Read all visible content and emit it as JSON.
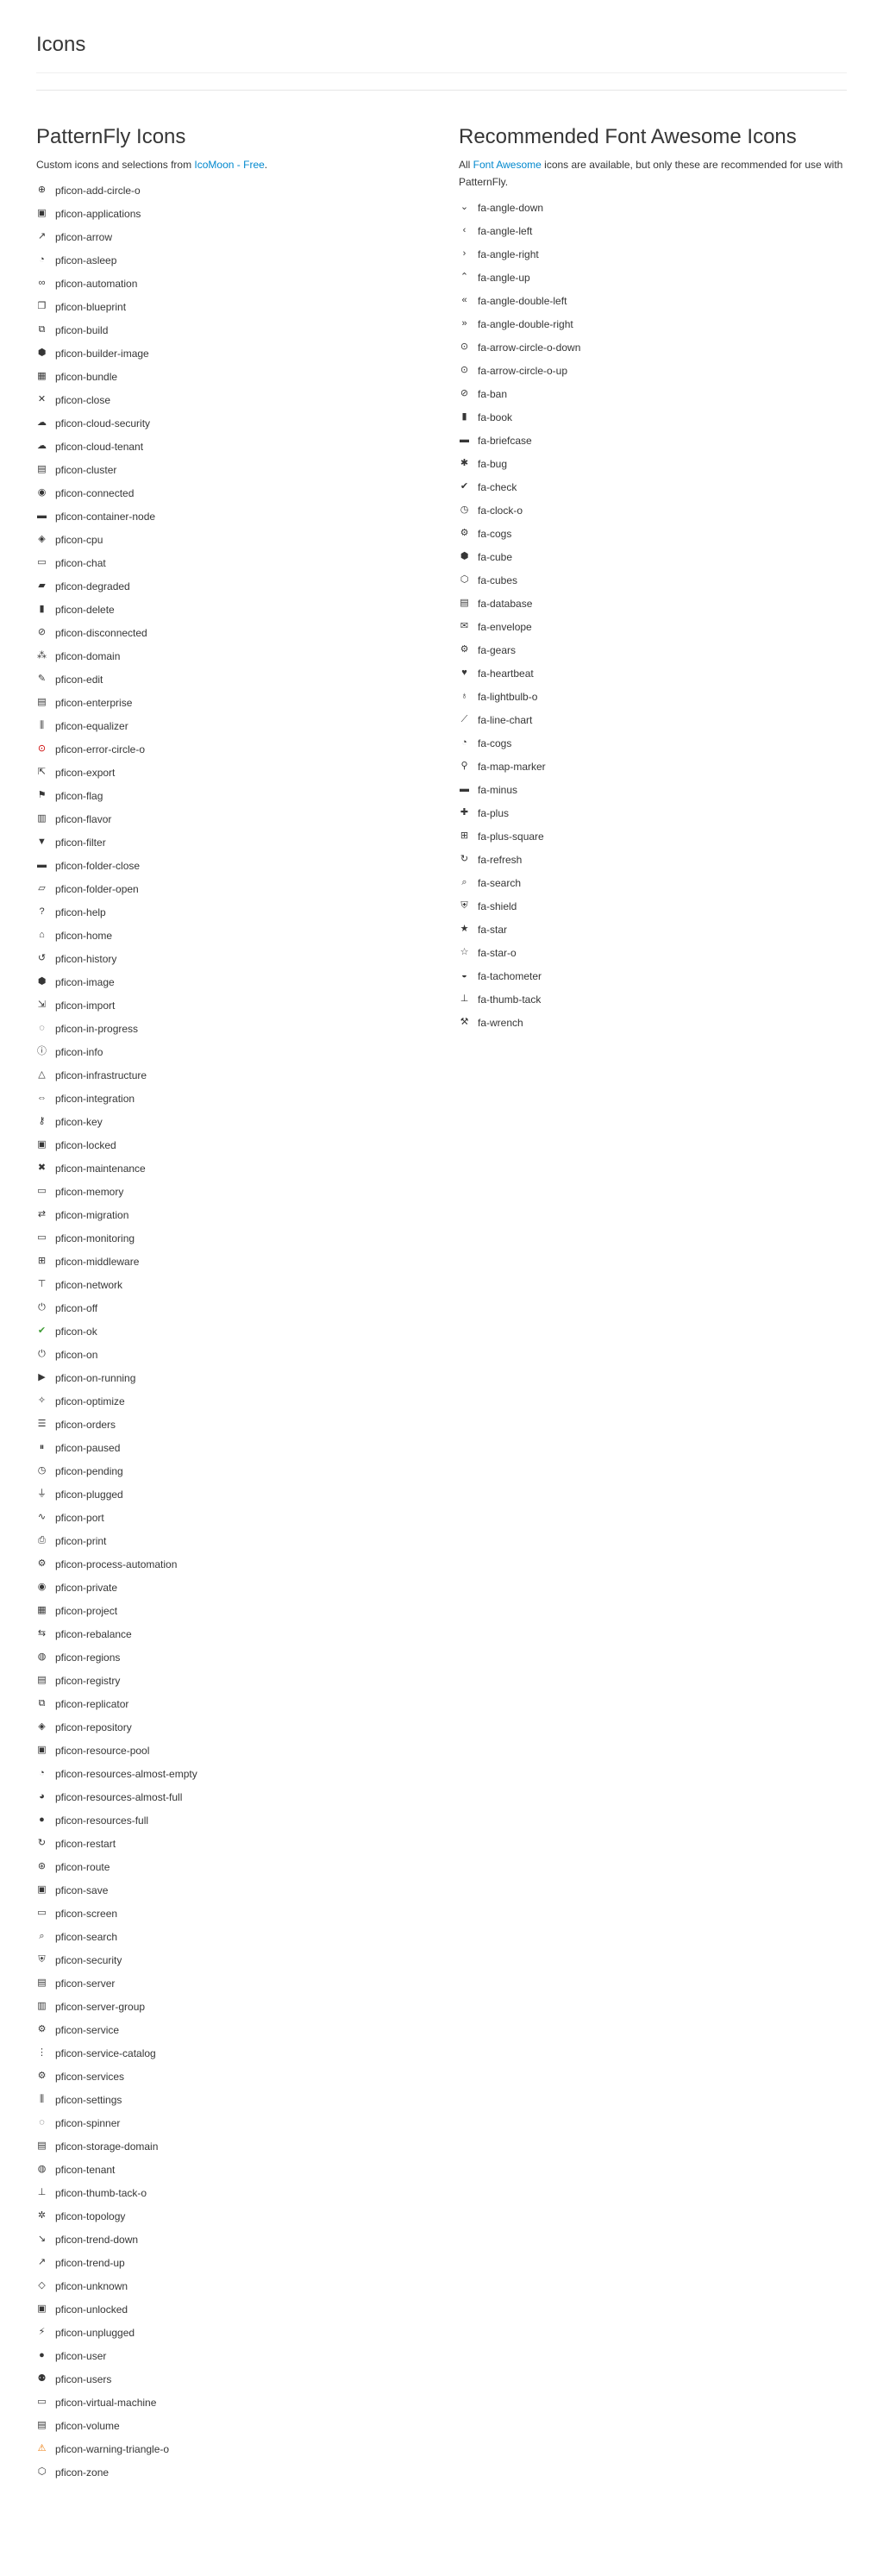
{
  "page": {
    "title": "Icons"
  },
  "left": {
    "title": "PatternFly Icons",
    "description_prefix": "Custom icons and selections from ",
    "description_link": "IcoMoon - Free",
    "description_suffix": ".",
    "icons": [
      {
        "name": "pficon-add-circle-o",
        "glyph": "⊕",
        "cls": ""
      },
      {
        "name": "pficon-applications",
        "glyph": "▣",
        "cls": ""
      },
      {
        "name": "pficon-arrow",
        "glyph": "↗",
        "cls": ""
      },
      {
        "name": "pficon-asleep",
        "glyph": "◔",
        "cls": ""
      },
      {
        "name": "pficon-automation",
        "glyph": "∞",
        "cls": ""
      },
      {
        "name": "pficon-blueprint",
        "glyph": "❐",
        "cls": ""
      },
      {
        "name": "pficon-build",
        "glyph": "⧉",
        "cls": ""
      },
      {
        "name": "pficon-builder-image",
        "glyph": "⬢",
        "cls": ""
      },
      {
        "name": "pficon-bundle",
        "glyph": "▦",
        "cls": ""
      },
      {
        "name": "pficon-close",
        "glyph": "✕",
        "cls": ""
      },
      {
        "name": "pficon-cloud-security",
        "glyph": "☁",
        "cls": ""
      },
      {
        "name": "pficon-cloud-tenant",
        "glyph": "☁",
        "cls": ""
      },
      {
        "name": "pficon-cluster",
        "glyph": "▤",
        "cls": ""
      },
      {
        "name": "pficon-connected",
        "glyph": "◉",
        "cls": ""
      },
      {
        "name": "pficon-container-node",
        "glyph": "▬",
        "cls": ""
      },
      {
        "name": "pficon-cpu",
        "glyph": "◈",
        "cls": ""
      },
      {
        "name": "pficon-chat",
        "glyph": "▭",
        "cls": ""
      },
      {
        "name": "pficon-degraded",
        "glyph": "▰",
        "cls": ""
      },
      {
        "name": "pficon-delete",
        "glyph": "▮",
        "cls": ""
      },
      {
        "name": "pficon-disconnected",
        "glyph": "⊘",
        "cls": ""
      },
      {
        "name": "pficon-domain",
        "glyph": "⁂",
        "cls": ""
      },
      {
        "name": "pficon-edit",
        "glyph": "✎",
        "cls": ""
      },
      {
        "name": "pficon-enterprise",
        "glyph": "▤",
        "cls": ""
      },
      {
        "name": "pficon-equalizer",
        "glyph": "⫼",
        "cls": ""
      },
      {
        "name": "pficon-error-circle-o",
        "glyph": "⊙",
        "cls": "err"
      },
      {
        "name": "pficon-export",
        "glyph": "⇱",
        "cls": ""
      },
      {
        "name": "pficon-flag",
        "glyph": "⚑",
        "cls": ""
      },
      {
        "name": "pficon-flavor",
        "glyph": "▥",
        "cls": ""
      },
      {
        "name": "pficon-filter",
        "glyph": "▼",
        "cls": ""
      },
      {
        "name": "pficon-folder-close",
        "glyph": "▬",
        "cls": ""
      },
      {
        "name": "pficon-folder-open",
        "glyph": "▱",
        "cls": ""
      },
      {
        "name": "pficon-help",
        "glyph": "?",
        "cls": ""
      },
      {
        "name": "pficon-home",
        "glyph": "⌂",
        "cls": ""
      },
      {
        "name": "pficon-history",
        "glyph": "↺",
        "cls": ""
      },
      {
        "name": "pficon-image",
        "glyph": "⬢",
        "cls": ""
      },
      {
        "name": "pficon-import",
        "glyph": "⇲",
        "cls": ""
      },
      {
        "name": "pficon-in-progress",
        "glyph": "◌",
        "cls": ""
      },
      {
        "name": "pficon-info",
        "glyph": "ⓘ",
        "cls": ""
      },
      {
        "name": "pficon-infrastructure",
        "glyph": "△",
        "cls": ""
      },
      {
        "name": "pficon-integration",
        "glyph": "⇔",
        "cls": ""
      },
      {
        "name": "pficon-key",
        "glyph": "⚷",
        "cls": ""
      },
      {
        "name": "pficon-locked",
        "glyph": "▣",
        "cls": ""
      },
      {
        "name": "pficon-maintenance",
        "glyph": "✖",
        "cls": ""
      },
      {
        "name": "pficon-memory",
        "glyph": "▭",
        "cls": ""
      },
      {
        "name": "pficon-migration",
        "glyph": "⇄",
        "cls": ""
      },
      {
        "name": "pficon-monitoring",
        "glyph": "▭",
        "cls": ""
      },
      {
        "name": "pficon-middleware",
        "glyph": "⊞",
        "cls": ""
      },
      {
        "name": "pficon-network",
        "glyph": "⊤",
        "cls": ""
      },
      {
        "name": "pficon-off",
        "glyph": "⏻",
        "cls": ""
      },
      {
        "name": "pficon-ok",
        "glyph": "✔",
        "cls": "ok"
      },
      {
        "name": "pficon-on",
        "glyph": "⏻",
        "cls": ""
      },
      {
        "name": "pficon-on-running",
        "glyph": "▶",
        "cls": ""
      },
      {
        "name": "pficon-optimize",
        "glyph": "✧",
        "cls": ""
      },
      {
        "name": "pficon-orders",
        "glyph": "☰",
        "cls": ""
      },
      {
        "name": "pficon-paused",
        "glyph": "⏸",
        "cls": ""
      },
      {
        "name": "pficon-pending",
        "glyph": "◷",
        "cls": ""
      },
      {
        "name": "pficon-plugged",
        "glyph": "⏚",
        "cls": ""
      },
      {
        "name": "pficon-port",
        "glyph": "∿",
        "cls": ""
      },
      {
        "name": "pficon-print",
        "glyph": "⎙",
        "cls": ""
      },
      {
        "name": "pficon-process-automation",
        "glyph": "⚙",
        "cls": ""
      },
      {
        "name": "pficon-private",
        "glyph": "◉",
        "cls": ""
      },
      {
        "name": "pficon-project",
        "glyph": "▦",
        "cls": ""
      },
      {
        "name": "pficon-rebalance",
        "glyph": "⇆",
        "cls": ""
      },
      {
        "name": "pficon-regions",
        "glyph": "◍",
        "cls": ""
      },
      {
        "name": "pficon-registry",
        "glyph": "▤",
        "cls": ""
      },
      {
        "name": "pficon-replicator",
        "glyph": "⧉",
        "cls": ""
      },
      {
        "name": "pficon-repository",
        "glyph": "◈",
        "cls": ""
      },
      {
        "name": "pficon-resource-pool",
        "glyph": "▣",
        "cls": ""
      },
      {
        "name": "pficon-resources-almost-empty",
        "glyph": "◔",
        "cls": ""
      },
      {
        "name": "pficon-resources-almost-full",
        "glyph": "◕",
        "cls": ""
      },
      {
        "name": "pficon-resources-full",
        "glyph": "●",
        "cls": ""
      },
      {
        "name": "pficon-restart",
        "glyph": "↻",
        "cls": ""
      },
      {
        "name": "pficon-route",
        "glyph": "⊛",
        "cls": ""
      },
      {
        "name": "pficon-save",
        "glyph": "▣",
        "cls": ""
      },
      {
        "name": "pficon-screen",
        "glyph": "▭",
        "cls": ""
      },
      {
        "name": "pficon-search",
        "glyph": "⌕",
        "cls": ""
      },
      {
        "name": "pficon-security",
        "glyph": "⛨",
        "cls": ""
      },
      {
        "name": "pficon-server",
        "glyph": "▤",
        "cls": ""
      },
      {
        "name": "pficon-server-group",
        "glyph": "▥",
        "cls": ""
      },
      {
        "name": "pficon-service",
        "glyph": "⚙",
        "cls": ""
      },
      {
        "name": "pficon-service-catalog",
        "glyph": "⋮",
        "cls": ""
      },
      {
        "name": "pficon-services",
        "glyph": "⚙",
        "cls": ""
      },
      {
        "name": "pficon-settings",
        "glyph": "⫼",
        "cls": ""
      },
      {
        "name": "pficon-spinner",
        "glyph": "◌",
        "cls": ""
      },
      {
        "name": "pficon-storage-domain",
        "glyph": "▤",
        "cls": ""
      },
      {
        "name": "pficon-tenant",
        "glyph": "◍",
        "cls": ""
      },
      {
        "name": "pficon-thumb-tack-o",
        "glyph": "⊥",
        "cls": ""
      },
      {
        "name": "pficon-topology",
        "glyph": "✲",
        "cls": ""
      },
      {
        "name": "pficon-trend-down",
        "glyph": "↘",
        "cls": ""
      },
      {
        "name": "pficon-trend-up",
        "glyph": "↗",
        "cls": ""
      },
      {
        "name": "pficon-unknown",
        "glyph": "◇",
        "cls": ""
      },
      {
        "name": "pficon-unlocked",
        "glyph": "▣",
        "cls": ""
      },
      {
        "name": "pficon-unplugged",
        "glyph": "⚡",
        "cls": ""
      },
      {
        "name": "pficon-user",
        "glyph": "●",
        "cls": ""
      },
      {
        "name": "pficon-users",
        "glyph": "⚉",
        "cls": ""
      },
      {
        "name": "pficon-virtual-machine",
        "glyph": "▭",
        "cls": ""
      },
      {
        "name": "pficon-volume",
        "glyph": "▤",
        "cls": ""
      },
      {
        "name": "pficon-warning-triangle-o",
        "glyph": "⚠",
        "cls": "warn"
      },
      {
        "name": "pficon-zone",
        "glyph": "⬡",
        "cls": ""
      }
    ]
  },
  "right": {
    "title": "Recommended Font Awesome Icons",
    "description_prefix": "All ",
    "description_link": "Font Awesome",
    "description_suffix": " icons are available, but only these are recommended for use with PatternFly.",
    "icons": [
      {
        "name": "fa-angle-down",
        "glyph": "⌄",
        "cls": ""
      },
      {
        "name": "fa-angle-left",
        "glyph": "‹",
        "cls": ""
      },
      {
        "name": "fa-angle-right",
        "glyph": "›",
        "cls": ""
      },
      {
        "name": "fa-angle-up",
        "glyph": "⌃",
        "cls": ""
      },
      {
        "name": "fa-angle-double-left",
        "glyph": "«",
        "cls": ""
      },
      {
        "name": "fa-angle-double-right",
        "glyph": "»",
        "cls": ""
      },
      {
        "name": "fa-arrow-circle-o-down",
        "glyph": "⊙",
        "cls": ""
      },
      {
        "name": "fa-arrow-circle-o-up",
        "glyph": "⊙",
        "cls": ""
      },
      {
        "name": "fa-ban",
        "glyph": "⊘",
        "cls": ""
      },
      {
        "name": "fa-book",
        "glyph": "▮",
        "cls": ""
      },
      {
        "name": "fa-briefcase",
        "glyph": "▬",
        "cls": ""
      },
      {
        "name": "fa-bug",
        "glyph": "✱",
        "cls": ""
      },
      {
        "name": "fa-check",
        "glyph": "✔",
        "cls": ""
      },
      {
        "name": "fa-clock-o",
        "glyph": "◷",
        "cls": ""
      },
      {
        "name": "fa-cogs",
        "glyph": "⚙",
        "cls": ""
      },
      {
        "name": "fa-cube",
        "glyph": "⬢",
        "cls": ""
      },
      {
        "name": "fa-cubes",
        "glyph": "⬡",
        "cls": ""
      },
      {
        "name": "fa-database",
        "glyph": "▤",
        "cls": ""
      },
      {
        "name": "fa-envelope",
        "glyph": "✉",
        "cls": ""
      },
      {
        "name": "fa-gears",
        "glyph": "⚙",
        "cls": ""
      },
      {
        "name": "fa-heartbeat",
        "glyph": "♥",
        "cls": ""
      },
      {
        "name": "fa-lightbulb-o",
        "glyph": "♁",
        "cls": ""
      },
      {
        "name": "fa-line-chart",
        "glyph": "⟋",
        "cls": ""
      },
      {
        "name": "fa-cogs",
        "glyph": "◔",
        "cls": ""
      },
      {
        "name": "fa-map-marker",
        "glyph": "⚲",
        "cls": ""
      },
      {
        "name": "fa-minus",
        "glyph": "▬",
        "cls": ""
      },
      {
        "name": "fa-plus",
        "glyph": "✚",
        "cls": ""
      },
      {
        "name": "fa-plus-square",
        "glyph": "⊞",
        "cls": ""
      },
      {
        "name": "fa-refresh",
        "glyph": "↻",
        "cls": ""
      },
      {
        "name": "fa-search",
        "glyph": "⌕",
        "cls": ""
      },
      {
        "name": "fa-shield",
        "glyph": "⛨",
        "cls": ""
      },
      {
        "name": "fa-star",
        "glyph": "★",
        "cls": ""
      },
      {
        "name": "fa-star-o",
        "glyph": "☆",
        "cls": ""
      },
      {
        "name": "fa-tachometer",
        "glyph": "◒",
        "cls": ""
      },
      {
        "name": "fa-thumb-tack",
        "glyph": "⊥",
        "cls": ""
      },
      {
        "name": "fa-wrench",
        "glyph": "⚒",
        "cls": ""
      }
    ]
  }
}
